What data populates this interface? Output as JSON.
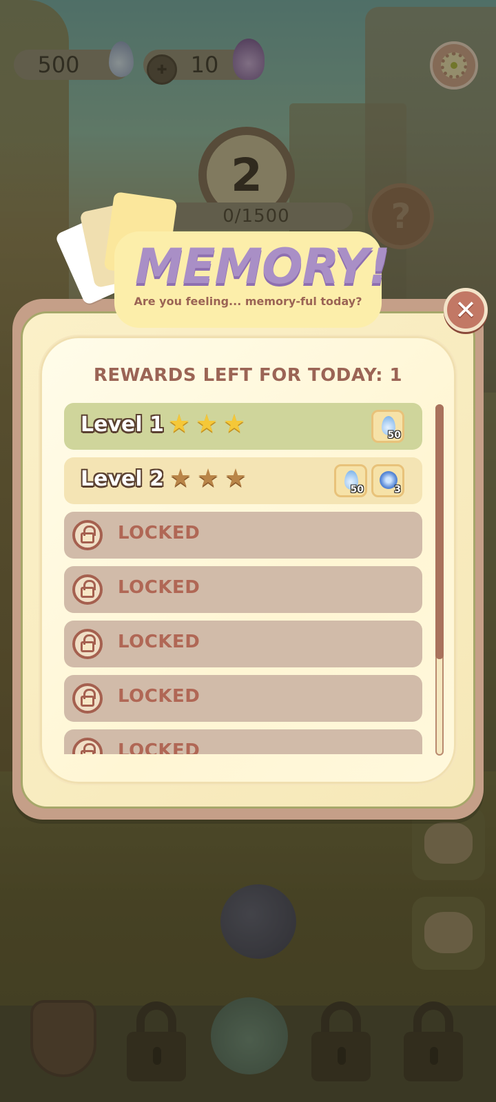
{
  "hud": {
    "currency_1": "500",
    "currency_2": "10",
    "level_number": "2",
    "progress_text": "0/1500",
    "help_label": "?"
  },
  "banner": {
    "title": "MEMORY!",
    "subtitle": "Are you feeling... memory-ful today?"
  },
  "modal": {
    "rewards_title": "REWARDS LEFT FOR TODAY: 1",
    "close_label": "✕",
    "scroll_position_fraction": 0
  },
  "levels": [
    {
      "label": "Level 1",
      "state": "completed",
      "stars": 3,
      "star_color": "gold",
      "rewards": [
        {
          "icon": "water-drop-icon",
          "qty": "50"
        }
      ]
    },
    {
      "label": "Level 2",
      "state": "available",
      "stars": 3,
      "star_color": "bronze",
      "rewards": [
        {
          "icon": "water-drop-icon",
          "qty": "50"
        },
        {
          "icon": "spirit-orb-icon",
          "qty": "3"
        }
      ]
    },
    {
      "label": "LOCKED",
      "state": "locked"
    },
    {
      "label": "LOCKED",
      "state": "locked"
    },
    {
      "label": "LOCKED",
      "state": "locked"
    },
    {
      "label": "LOCKED",
      "state": "locked"
    },
    {
      "label": "LOCKED",
      "state": "locked"
    }
  ],
  "colors": {
    "completed_row": "#cfd59b",
    "available_row": "#f4e4b4",
    "locked_row": "#d1bba9",
    "title_text": "#9b6455",
    "banner_title": "#a98fc6"
  }
}
